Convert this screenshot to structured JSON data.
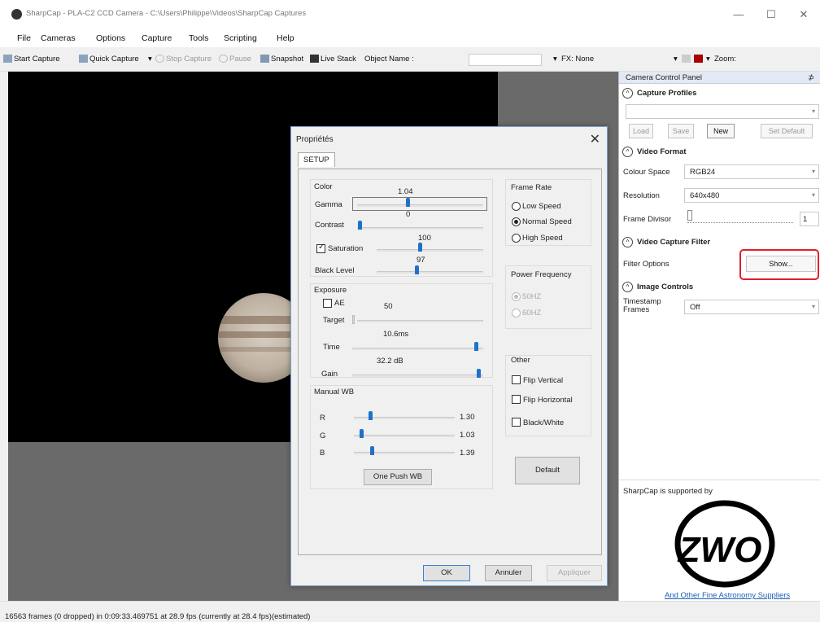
{
  "window": {
    "title": "SharpCap - PLA-C2 CCD Camera - C:\\Users\\Philippe\\Videos\\SharpCap Captures",
    "minimize": "—",
    "maximize": "☐",
    "close": "✕"
  },
  "menu": [
    "File",
    "Cameras",
    "Options",
    "Capture",
    "Tools",
    "Scripting",
    "Help"
  ],
  "toolbar": {
    "start_capture": "Start Capture",
    "quick_capture": "Quick Capture",
    "stop_capture": "Stop Capture",
    "pause": "Pause",
    "snapshot": "Snapshot",
    "live_stack": "Live Stack",
    "object_name_label": "Object Name :",
    "object_name_value": "",
    "fx_label": "FX: None",
    "zoom_label": "Zoom:"
  },
  "control_panel": {
    "header": "Camera Control Panel",
    "pin": "⊅",
    "capture_profiles": {
      "title": "Capture Profiles",
      "selected": "",
      "buttons": [
        "Load",
        "Save",
        "New",
        "Set Default"
      ]
    },
    "video_format": {
      "title": "Video Format",
      "colour_space_label": "Colour Space",
      "colour_space_value": "RGB24",
      "resolution_label": "Resolution",
      "resolution_value": "640x480",
      "frame_divisor_label": "Frame Divisor",
      "frame_divisor_value": "1"
    },
    "video_capture_filter": {
      "title": "Video Capture Filter",
      "filter_options_label": "Filter Options",
      "show_button": "Show..."
    },
    "image_controls": {
      "title": "Image Controls",
      "timestamp_label": "Timestamp Frames",
      "timestamp_value": "Off"
    },
    "supported_by": "SharpCap is supported by",
    "sponsor_logo_text": "ZWO",
    "sponsor_link": "And Other Fine Astronomy Suppliers"
  },
  "dialog": {
    "title": "Propriétés",
    "close": "✕",
    "tab": "SETUP",
    "color_group": {
      "label": "Color",
      "gamma_label": "Gamma",
      "gamma_value": "1.04",
      "gamma_min": "0",
      "contrast_label": "Contrast",
      "saturation_label": "Saturation",
      "saturation_checked": true,
      "saturation_value": "100",
      "black_level_label": "Black Level",
      "black_level_value": "97"
    },
    "exposure_group": {
      "label": "Exposure",
      "ae_label": "AE",
      "ae_checked": false,
      "target_value": "50",
      "target_label": "Target",
      "time_label": "Time",
      "time_value": "10.6ms",
      "gain_label": "Gain",
      "gain_value": "32.2 dB"
    },
    "manual_wb_group": {
      "label": "Manual WB",
      "r_label": "R",
      "r_value": "1.30",
      "g_label": "G",
      "g_value": "1.03",
      "b_label": "B",
      "b_value": "1.39",
      "one_push_button": "One Push WB"
    },
    "frame_rate_group": {
      "label": "Frame Rate",
      "options": [
        "Low Speed",
        "Normal Speed",
        "High Speed"
      ],
      "selected": "Normal Speed"
    },
    "power_freq_group": {
      "label": "Power Frequency",
      "options": [
        "50HZ",
        "60HZ"
      ],
      "selected": "50HZ"
    },
    "other_group": {
      "label": "Other",
      "flip_vertical": "Flip Vertical",
      "flip_horizontal": "Flip Horizontal",
      "black_white": "Black/White"
    },
    "default_button": "Default",
    "ok_button": "OK",
    "cancel_button": "Annuler",
    "apply_button": "Appliquer"
  },
  "status": {
    "text": "16563 frames (0 dropped) in 0:09:33.469751 at 28.9 fps  (currently at 28.4 fps)(estimated)"
  },
  "colors": {
    "accent": "#1e73c8",
    "highlight_ring": "#e0202a",
    "viewport_bg": "#000000",
    "workspace_grey": "#6a6a6a"
  }
}
